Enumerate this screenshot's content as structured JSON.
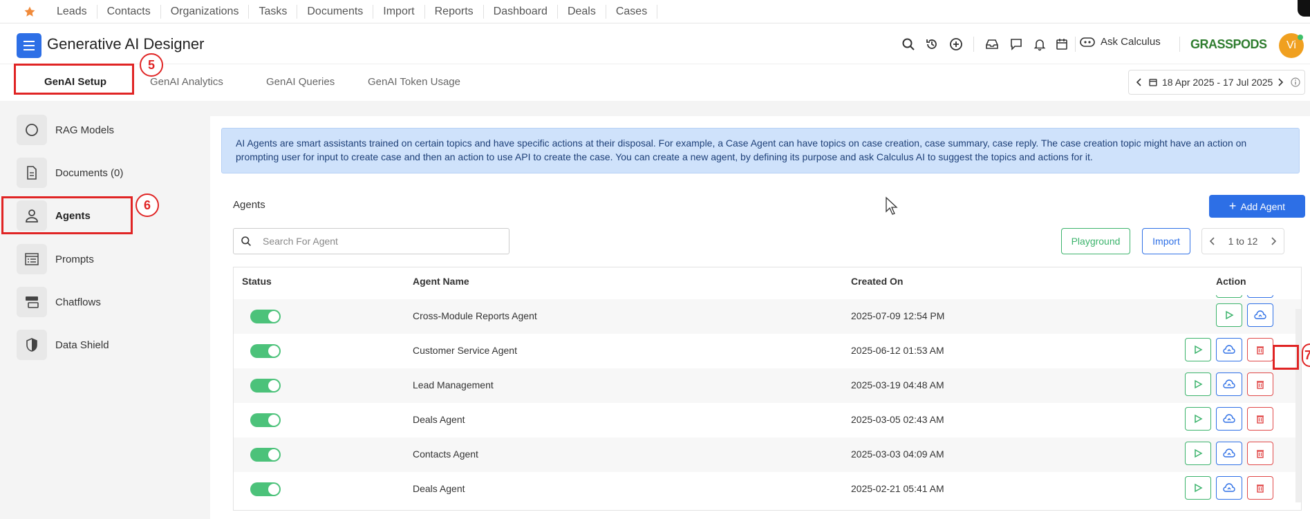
{
  "topnav": {
    "items": [
      "Leads",
      "Contacts",
      "Organizations",
      "Tasks",
      "Documents",
      "Import",
      "Reports",
      "Dashboard",
      "Deals",
      "Cases"
    ]
  },
  "header": {
    "title": "Generative AI Designer",
    "ask_label": "Ask Calculus",
    "logo_text": "GRASSPODS",
    "avatar_initials": "Vi"
  },
  "tabs": [
    "GenAI Setup",
    "GenAI Analytics",
    "GenAI Queries",
    "GenAI Token Usage"
  ],
  "date_range": "18 Apr 2025 - 17 Jul 2025",
  "sidebar": {
    "items": [
      {
        "label": "RAG Models",
        "icon": "circle-icon"
      },
      {
        "label": "Documents (0)",
        "icon": "document-icon"
      },
      {
        "label": "Agents",
        "icon": "user-icon"
      },
      {
        "label": "Prompts",
        "icon": "list-icon"
      },
      {
        "label": "Chatflows",
        "icon": "chatflow-icon"
      },
      {
        "label": "Data Shield",
        "icon": "shield-icon"
      }
    ]
  },
  "annotations": {
    "tab_marker": "5",
    "sidebar_marker": "6",
    "delete_marker": "7"
  },
  "info_text": "AI Agents are smart assistants trained on certain topics and have specific actions at their disposal. For example, a Case Agent can have topics on case creation, case summary, case reply. The case creation topic might have an action on prompting user for input to create case and then an action to use API to create the case. You can create a new agent, by defining its purpose and ask Calculus AI to suggest the topics and actions for it.",
  "agents_section": {
    "title": "Agents",
    "add_button": "Add Agent",
    "search_placeholder": "Search For Agent",
    "playground_button": "Playground",
    "import_button": "Import",
    "pager_text": "1 to 12"
  },
  "table": {
    "headers": {
      "status": "Status",
      "name": "Agent Name",
      "created": "Created On",
      "action": "Action"
    },
    "rows": [
      {
        "name": "Cross-Module Reports Agent",
        "created": "2025-07-09 12:54 PM",
        "enabled": true
      },
      {
        "name": "Customer Service Agent",
        "created": "2025-06-12 01:53 AM",
        "enabled": true
      },
      {
        "name": "Lead Management",
        "created": "2025-03-19 04:48 AM",
        "enabled": true
      },
      {
        "name": "Deals Agent",
        "created": "2025-03-05 02:43 AM",
        "enabled": true
      },
      {
        "name": "Contacts Agent",
        "created": "2025-03-03 04:09 AM",
        "enabled": true
      },
      {
        "name": "Deals Agent",
        "created": "2025-02-21 05:41 AM",
        "enabled": true
      }
    ]
  },
  "colors": {
    "accent": "#2d6fe6",
    "annotation": "#e02424",
    "toggle_on": "#4cc27a",
    "play": "#3bb36b",
    "delete": "#e04848",
    "info_bg": "#cfe2fb"
  }
}
